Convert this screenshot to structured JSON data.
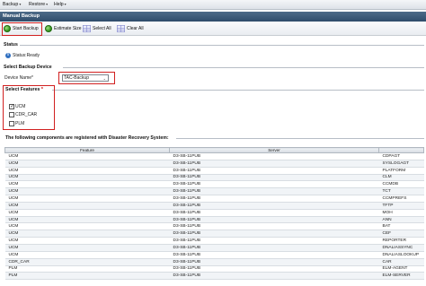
{
  "menu": [
    {
      "label": "Backup"
    },
    {
      "label": "Restore"
    },
    {
      "label": "Help"
    }
  ],
  "page_title": "Manual Backup",
  "toolbar": {
    "start_backup": "Start Backup",
    "estimate_size": "Estimate Size",
    "select_all": "Select All",
    "clear_all": "Clear All"
  },
  "status": {
    "heading": "Status",
    "text": "Status:Ready"
  },
  "device": {
    "heading": "Select Backup Device",
    "label": "Device Name*",
    "selected": "TAC-Backup"
  },
  "features": {
    "heading": "Select Features",
    "required_mark": "*",
    "items": [
      {
        "label": "UCM",
        "checked": true
      },
      {
        "label": "CDR_CAR",
        "checked": false
      },
      {
        "label": "PLM",
        "checked": false
      }
    ]
  },
  "components": {
    "heading": "The following components are registered with Disaster Recovery System:",
    "columns": [
      "Feature",
      "Server",
      ""
    ],
    "rows": [
      [
        "UCM",
        "D3-SB-11PUB",
        "CDPAGT"
      ],
      [
        "UCM",
        "D3-SB-11PUB",
        "SYSLOGAGT"
      ],
      [
        "UCM",
        "D3-SB-11PUB",
        "PLATFORM"
      ],
      [
        "UCM",
        "D3-SB-11PUB",
        "CLM"
      ],
      [
        "UCM",
        "D3-SB-11PUB",
        "CCMDB"
      ],
      [
        "UCM",
        "D3-SB-11PUB",
        "TCT"
      ],
      [
        "UCM",
        "D3-SB-11PUB",
        "CCMPREFS"
      ],
      [
        "UCM",
        "D3-SB-11PUB",
        "TFTP"
      ],
      [
        "UCM",
        "D3-SB-11PUB",
        "MOH"
      ],
      [
        "UCM",
        "D3-SB-11PUB",
        "ANN"
      ],
      [
        "UCM",
        "D3-SB-11PUB",
        "BAT"
      ],
      [
        "UCM",
        "D3-SB-11PUB",
        "CEF"
      ],
      [
        "UCM",
        "D3-SB-11PUB",
        "REPORTER"
      ],
      [
        "UCM",
        "D3-SB-11PUB",
        "DNALIASSYNC"
      ],
      [
        "UCM",
        "D3-SB-11PUB",
        "DNALIASLOOKUP"
      ],
      [
        "CDR_CAR",
        "D3-SB-11PUB",
        "CAR"
      ],
      [
        "PLM",
        "D3-SB-11PUB",
        "ELM-AGENT"
      ],
      [
        "PLM",
        "D3-SB-11PUB",
        "ELM-SERVER"
      ]
    ]
  }
}
